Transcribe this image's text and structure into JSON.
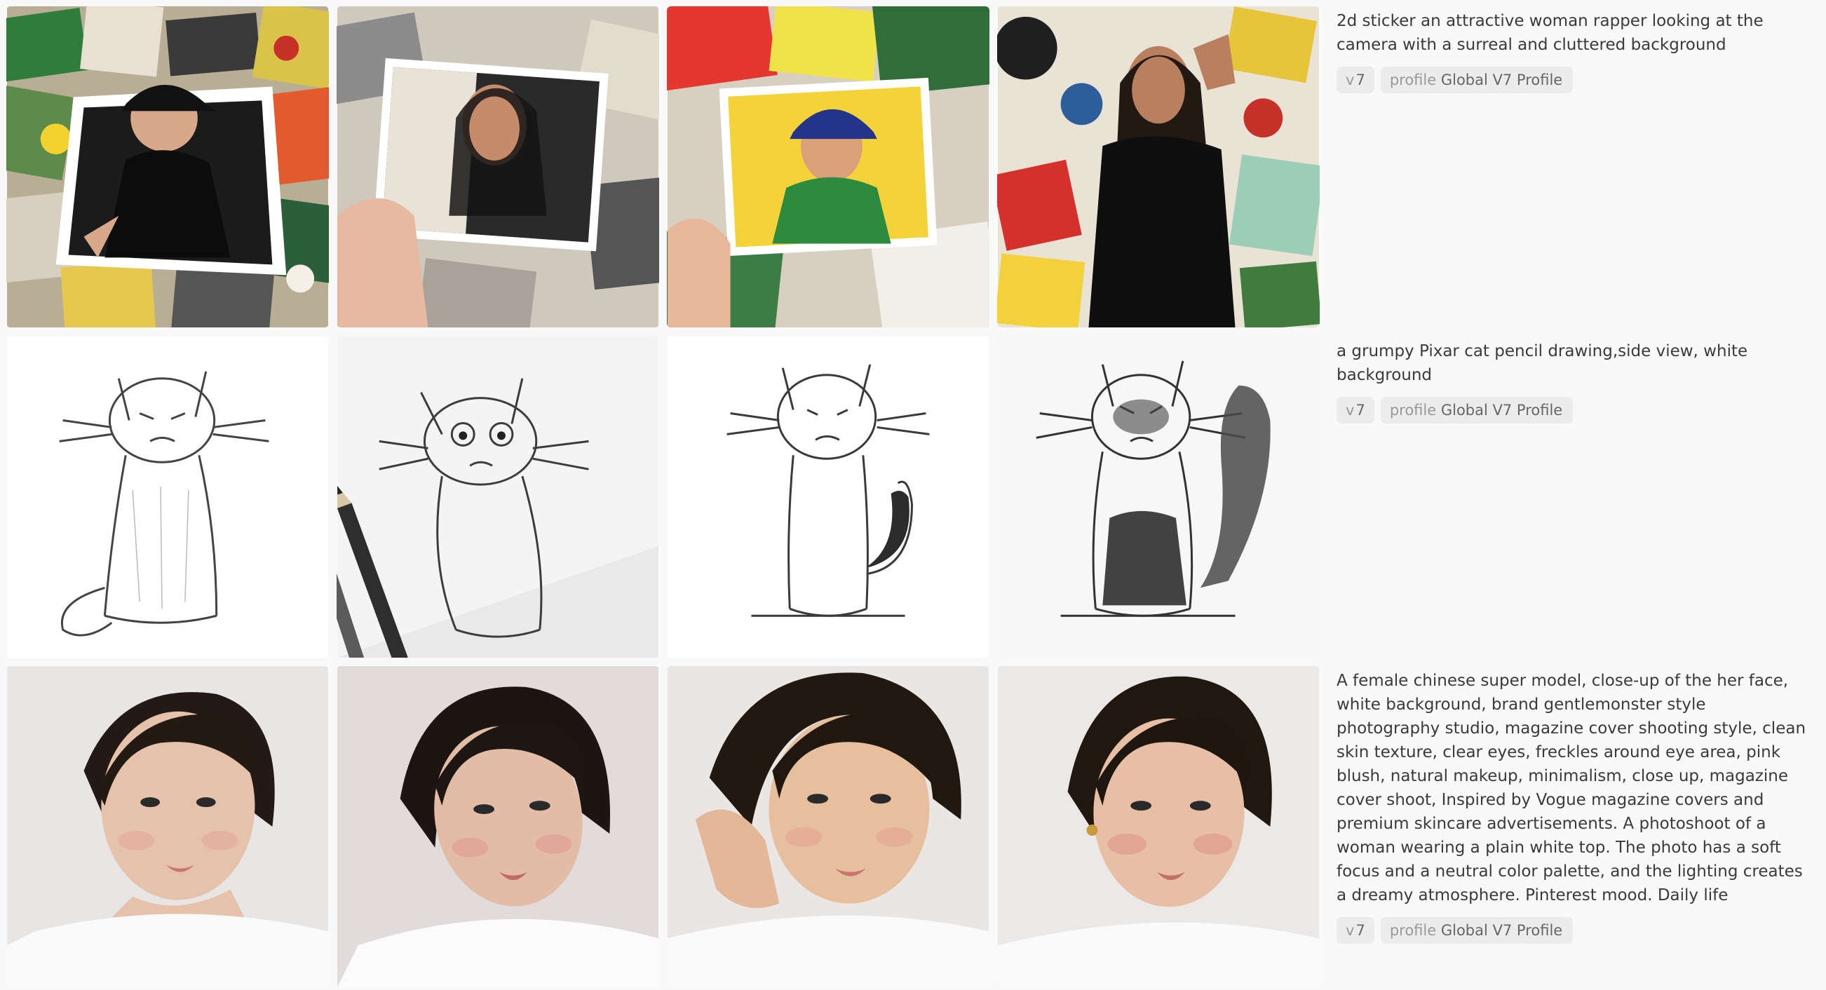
{
  "rows": [
    {
      "prompt": "2d sticker an attractive woman rapper looking at the camera with a surreal and cluttered background",
      "version_prefix": "v",
      "version_value": "7",
      "profile_prefix": "profile",
      "profile_value": "Global V7 Profile",
      "thumbnails": [
        "sticker-collage-woman-cap",
        "sticker-card-held-woman",
        "sticker-card-woman-blue-cap",
        "woman-black-top-collage-wall"
      ]
    },
    {
      "prompt": "a grumpy Pixar cat pencil drawing,side view, white background",
      "version_prefix": "v",
      "version_value": "7",
      "profile_prefix": "profile",
      "profile_value": "Global V7 Profile",
      "thumbnails": [
        "grumpy-cat-sketch-sitting",
        "grumpy-cat-sketch-with-pencil",
        "grumpy-cat-sketch-front",
        "grumpy-cat-sketch-shaded"
      ]
    },
    {
      "prompt": "A female chinese super model, close-up of the her face, white background, brand gentlemonster style photography studio, magazine cover shooting style, clean skin texture, clear eyes, freckles around eye area, pink blush, natural makeup, minimalism, close up, magazine cover shoot, Inspired by Vogue magazine covers and premium skincare advertisements. A photoshoot of a woman wearing a plain white top. The photo has a soft focus and a neutral color palette, and the lighting creates a dreamy atmosphere. Pinterest mood. Daily life",
      "version_prefix": "v",
      "version_value": "7",
      "profile_prefix": "profile",
      "profile_value": "Global V7 Profile",
      "thumbnails": [
        "model-portrait-close-up",
        "model-portrait-tilted-head",
        "model-portrait-hand-on-cheek",
        "model-portrait-earring"
      ]
    }
  ]
}
